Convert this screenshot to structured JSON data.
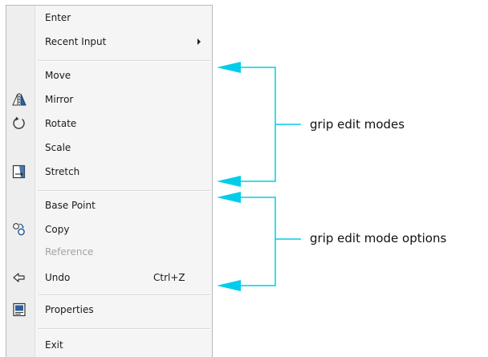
{
  "menu": {
    "items": {
      "enter": "Enter",
      "recent_input": "Recent Input",
      "move": "Move",
      "mirror": "Mirror",
      "rotate": "Rotate",
      "scale": "Scale",
      "stretch": "Stretch",
      "base_point": "Base Point",
      "copy": "Copy",
      "reference": "Reference",
      "undo": "Undo",
      "undo_shortcut": "Ctrl+Z",
      "properties": "Properties",
      "exit": "Exit"
    },
    "disabled_items": [
      "Reference"
    ],
    "icons": {
      "mirror": "mirror-icon",
      "rotate": "rotate-icon",
      "stretch": "stretch-icon",
      "copy": "copy-icon",
      "undo": "undo-icon",
      "properties": "properties-icon",
      "recent_input": "submenu-arrow-icon"
    }
  },
  "annotations": {
    "modes": "grip edit modes",
    "options": "grip edit mode options"
  },
  "colors": {
    "callout": "#00cdea",
    "menu_background": "#f5f5f5",
    "icon_blue": "#2b5f9e",
    "disabled_text": "#a3a3a3"
  }
}
